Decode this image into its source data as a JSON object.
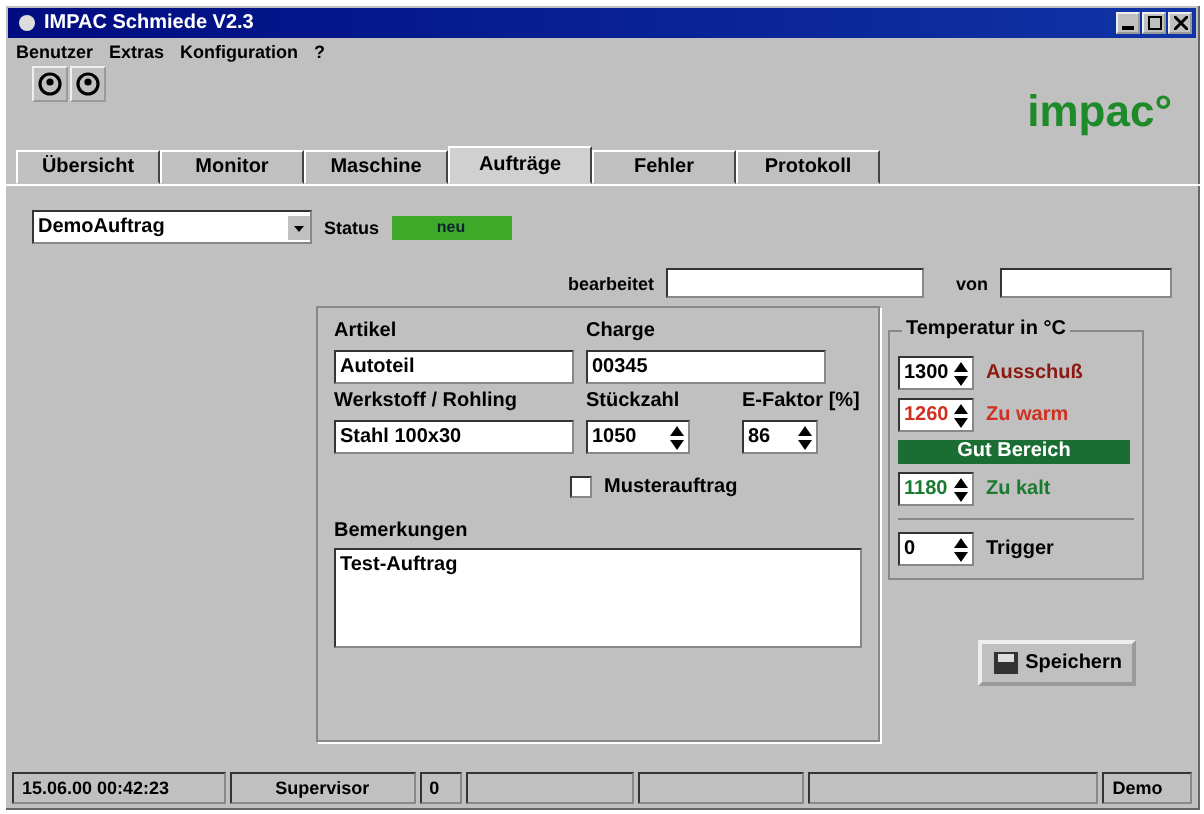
{
  "window": {
    "title": "IMPAC Schmiede V2.3"
  },
  "menu": [
    "Benutzer",
    "Extras",
    "Konfiguration",
    "?"
  ],
  "logo": "impac°",
  "tabs": [
    {
      "label": "Übersicht",
      "selected": false
    },
    {
      "label": "Monitor",
      "selected": false
    },
    {
      "label": "Maschine",
      "selected": false
    },
    {
      "label": "Aufträge",
      "selected": true
    },
    {
      "label": "Fehler",
      "selected": false
    },
    {
      "label": "Protokoll",
      "selected": false
    }
  ],
  "order": {
    "value": "DemoAuftrag"
  },
  "status": {
    "label": "Status",
    "value": "neu",
    "color": "#3faa2a"
  },
  "edited": {
    "label": "bearbeitet"
  },
  "by": {
    "label": "von"
  },
  "fields": {
    "article_label": "Artikel",
    "article": "Autoteil",
    "batch_label": "Charge",
    "batch": "00345",
    "material_label": "Werkstoff / Rohling",
    "material": "Stahl 100x30",
    "count_label": "Stückzahl",
    "count": "1050",
    "factor_label": "E-Faktor [%]",
    "factor": "86"
  },
  "sample": {
    "label": "Musterauftrag",
    "checked": false
  },
  "notes": {
    "label": "Bemerkungen",
    "value": "Test-Auftrag"
  },
  "temperature": {
    "title": "Temperatur in °C",
    "rows": [
      {
        "value": "1300",
        "label": "Ausschuß",
        "color": "#8a1a10",
        "value_tinted": false
      },
      {
        "value": "1260",
        "label": "Zu warm",
        "color": "#d03020",
        "value_tinted": true
      }
    ],
    "band": "Gut Bereich",
    "lower": {
      "value": "1180",
      "label": "Zu kalt",
      "color": "#1a7a30",
      "value_tinted": true
    },
    "trigger": {
      "value": "0",
      "label": "Trigger"
    }
  },
  "save_button": "Speichern",
  "status_bar": [
    {
      "kind": "text",
      "text": "15.06.00 00:42:23"
    },
    {
      "kind": "text",
      "text": "Supervisor"
    },
    {
      "kind": "text",
      "text": "0"
    },
    {
      "kind": "blank"
    },
    {
      "kind": "blank"
    },
    {
      "kind": "blank"
    },
    {
      "kind": "text",
      "text": "Demo"
    }
  ]
}
